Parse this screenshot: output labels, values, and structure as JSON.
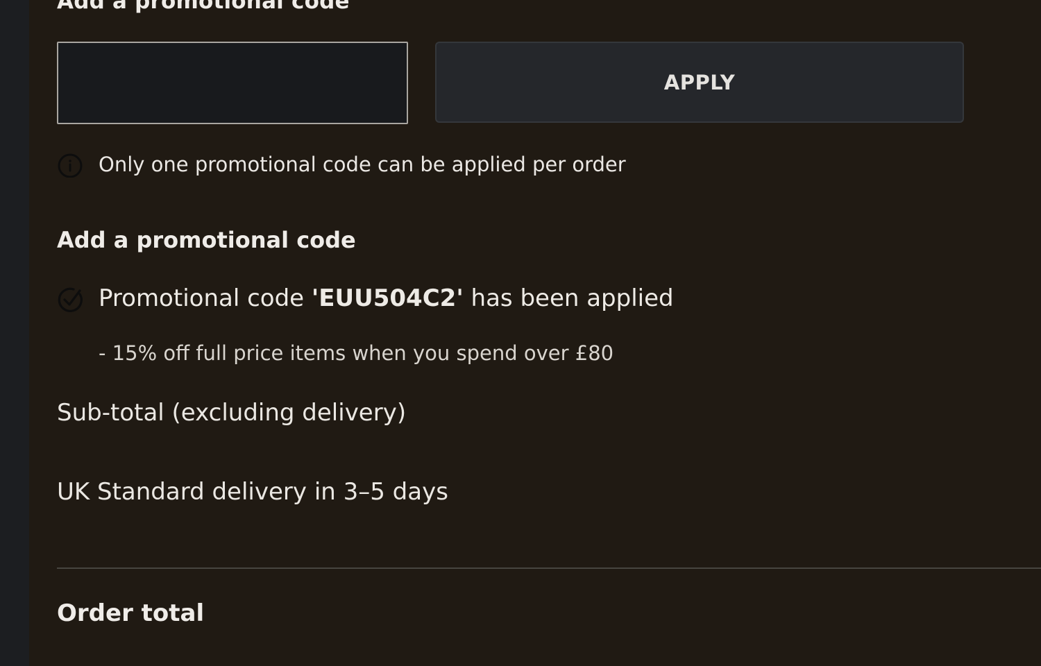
{
  "promo": {
    "heading_top": "Add a promotional code",
    "input_value": "",
    "input_placeholder": "",
    "apply_label": "APPLY",
    "info_text": "Only one promotional code can be applied per order",
    "section_title": "Add a promotional code",
    "applied_prefix": "Promotional code ",
    "applied_code": "'EUU504C2'",
    "applied_suffix": " has been applied",
    "discount_description": "- 15% off full price items when you spend over £80"
  },
  "summary": {
    "subtotal_label": "Sub-total (excluding delivery)",
    "delivery_label": "UK Standard delivery in 3–5 days",
    "order_total_label": "Order total"
  },
  "icons": {
    "info": "info-icon",
    "check": "check-circle-icon"
  },
  "colors": {
    "background": "#201a13",
    "rail": "#1c1e21",
    "button": "#25272b",
    "text": "#e9e6e1"
  }
}
